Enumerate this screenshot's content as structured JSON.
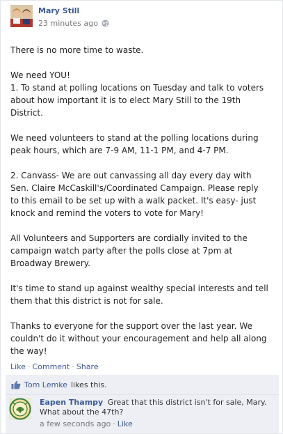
{
  "post": {
    "author": "Mary Still",
    "timestamp": "23 minutes ago",
    "privacy_icon": "globe-icon",
    "body": "There is no more time to waste.\n\nWe need YOU!\n1. To stand at polling locations on Tuesday and talk to voters about how important it is to elect Mary Still to the 19th District.\n\nWe need volunteers to stand at the polling locations during peak hours, which are 7-9 AM, 11-1 PM, and 4-7 PM.\n\n2. Canvass- We are out canvassing all day every day with Sen. Claire McCaskill's/Coordinated Campaign. Please reply to this email to be set up with a walk packet. It's easy- just knock and remind the voters to vote for Mary!\n\nAll Volunteers and Supporters are cordially invited to the campaign watch party after the polls close at 7pm at Broadway Brewery.\n\nIt's time to stand up against wealthy special interests and tell them that this district is not for sale.\n\nThanks to everyone for the support over the last year. We couldn't do it without your encouragement and help all along the way!"
  },
  "actions": {
    "like": "Like",
    "comment": "Comment",
    "share": "Share",
    "separator": "·"
  },
  "likes": {
    "name": "Tom Lemke",
    "suffix": "likes this."
  },
  "comment": {
    "author": "Eapen Thampy",
    "text": "Great that this district isn't for sale, Mary. What about the 47th?",
    "timestamp": "a few seconds ago",
    "like": "Like",
    "separator": "·"
  },
  "colors": {
    "link": "#3b5998",
    "ufi_background": "#edeff4"
  }
}
